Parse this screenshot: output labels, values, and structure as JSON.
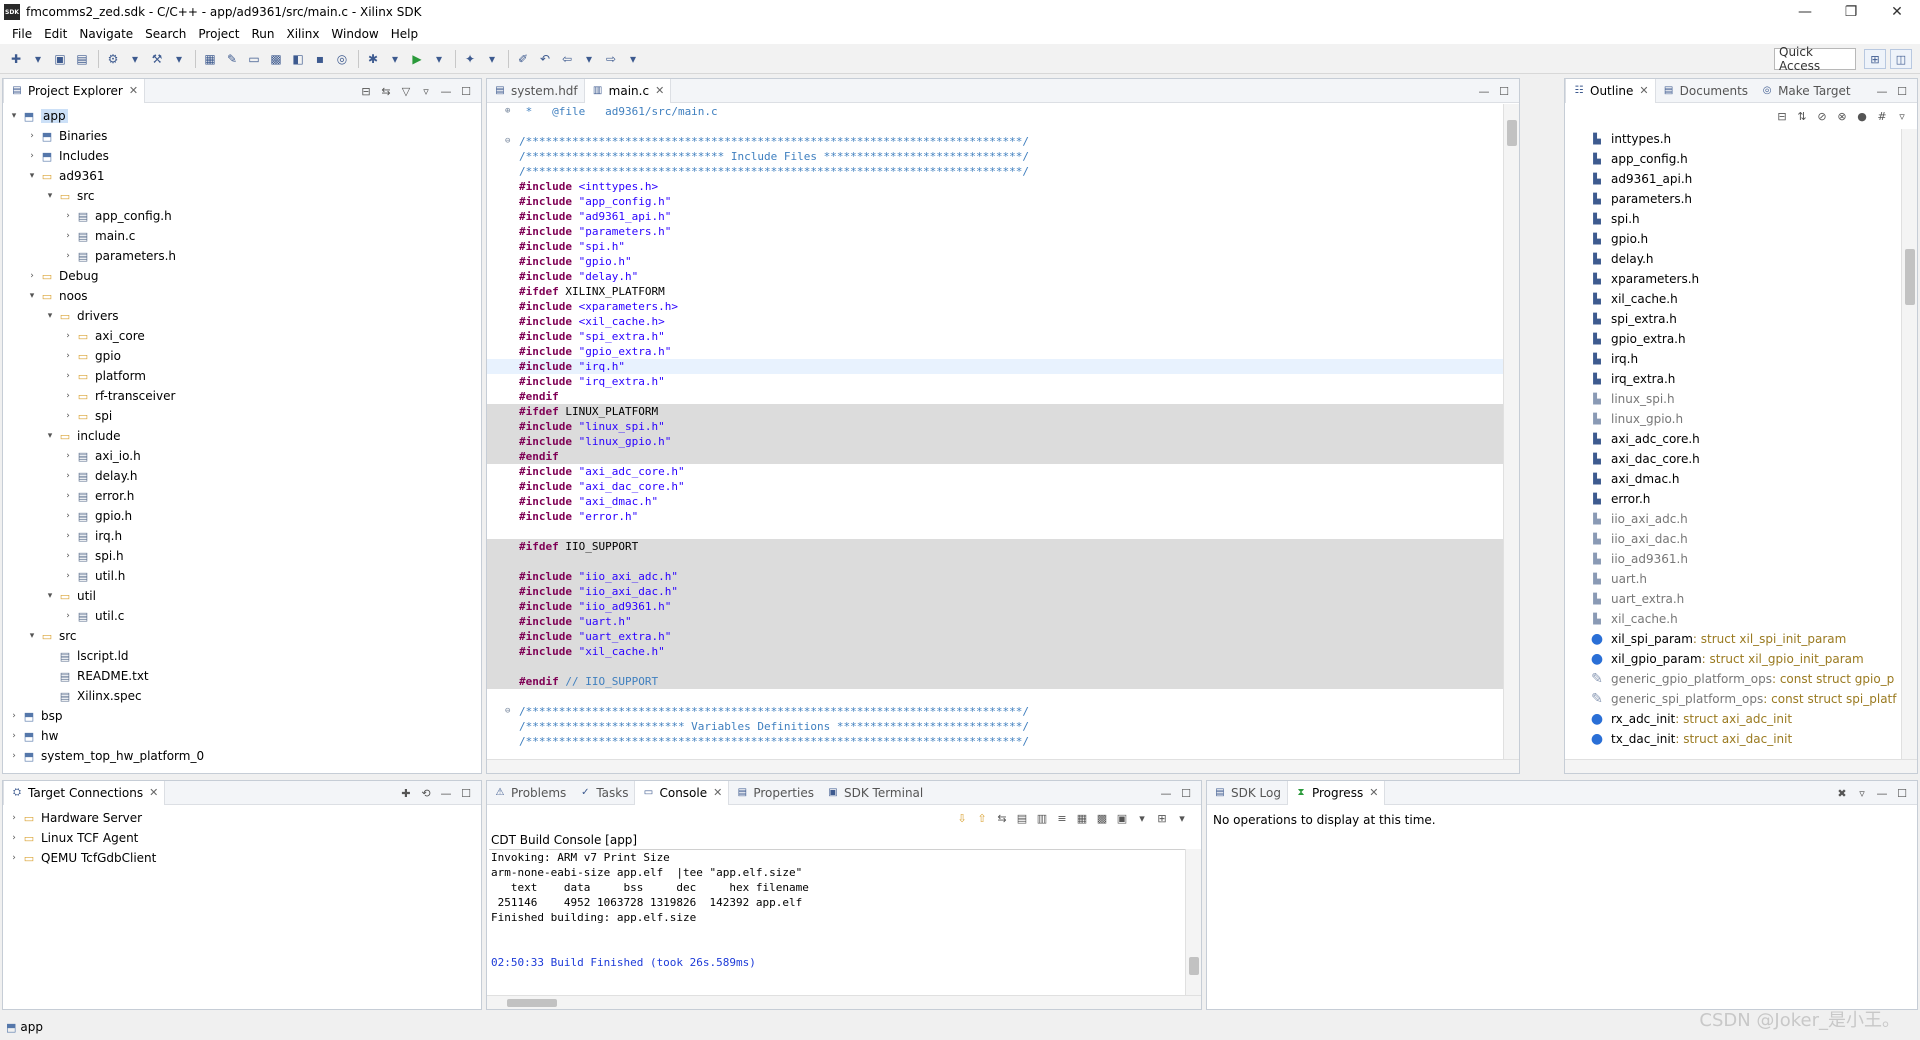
{
  "window": {
    "title": "fmcomms2_zed.sdk - C/C++ - app/ad9361/src/main.c - Xilinx SDK",
    "icon_text": "SDK",
    "controls": [
      "—",
      "❐",
      "✕"
    ]
  },
  "menu": [
    "File",
    "Edit",
    "Navigate",
    "Search",
    "Project",
    "Run",
    "Xilinx",
    "Window",
    "Help"
  ],
  "toolbar": {
    "quick_access": "Quick Access"
  },
  "project_explorer": {
    "title": "Project Explorer",
    "items": [
      {
        "label": "app",
        "depth": 0,
        "tw": "▾",
        "icon": "proj",
        "selected": true
      },
      {
        "label": "Binaries",
        "depth": 1,
        "tw": "›",
        "icon": "proj"
      },
      {
        "label": "Includes",
        "depth": 1,
        "tw": "›",
        "icon": "proj"
      },
      {
        "label": "ad9361",
        "depth": 1,
        "tw": "▾",
        "icon": "folder"
      },
      {
        "label": "src",
        "depth": 2,
        "tw": "▾",
        "icon": "folder"
      },
      {
        "label": "app_config.h",
        "depth": 3,
        "tw": "›",
        "icon": "file"
      },
      {
        "label": "main.c",
        "depth": 3,
        "tw": "›",
        "icon": "file"
      },
      {
        "label": "parameters.h",
        "depth": 3,
        "tw": "›",
        "icon": "file"
      },
      {
        "label": "Debug",
        "depth": 1,
        "tw": "›",
        "icon": "folder"
      },
      {
        "label": "noos",
        "depth": 1,
        "tw": "▾",
        "icon": "folder"
      },
      {
        "label": "drivers",
        "depth": 2,
        "tw": "▾",
        "icon": "folder"
      },
      {
        "label": "axi_core",
        "depth": 3,
        "tw": "›",
        "icon": "folder"
      },
      {
        "label": "gpio",
        "depth": 3,
        "tw": "›",
        "icon": "folder"
      },
      {
        "label": "platform",
        "depth": 3,
        "tw": "›",
        "icon": "folder"
      },
      {
        "label": "rf-transceiver",
        "depth": 3,
        "tw": "›",
        "icon": "folder"
      },
      {
        "label": "spi",
        "depth": 3,
        "tw": "›",
        "icon": "folder"
      },
      {
        "label": "include",
        "depth": 2,
        "tw": "▾",
        "icon": "folder"
      },
      {
        "label": "axi_io.h",
        "depth": 3,
        "tw": "›",
        "icon": "file"
      },
      {
        "label": "delay.h",
        "depth": 3,
        "tw": "›",
        "icon": "file"
      },
      {
        "label": "error.h",
        "depth": 3,
        "tw": "›",
        "icon": "file"
      },
      {
        "label": "gpio.h",
        "depth": 3,
        "tw": "›",
        "icon": "file"
      },
      {
        "label": "irq.h",
        "depth": 3,
        "tw": "›",
        "icon": "file"
      },
      {
        "label": "spi.h",
        "depth": 3,
        "tw": "›",
        "icon": "file"
      },
      {
        "label": "util.h",
        "depth": 3,
        "tw": "›",
        "icon": "file"
      },
      {
        "label": "util",
        "depth": 2,
        "tw": "▾",
        "icon": "folder"
      },
      {
        "label": "util.c",
        "depth": 3,
        "tw": "›",
        "icon": "file"
      },
      {
        "label": "src",
        "depth": 1,
        "tw": "▾",
        "icon": "folder"
      },
      {
        "label": "lscript.ld",
        "depth": 2,
        "tw": "",
        "icon": "file"
      },
      {
        "label": "README.txt",
        "depth": 2,
        "tw": "",
        "icon": "file"
      },
      {
        "label": "Xilinx.spec",
        "depth": 2,
        "tw": "",
        "icon": "file"
      },
      {
        "label": "bsp",
        "depth": 0,
        "tw": "›",
        "icon": "proj"
      },
      {
        "label": "hw",
        "depth": 0,
        "tw": "›",
        "icon": "proj"
      },
      {
        "label": "system_top_hw_platform_0",
        "depth": 0,
        "tw": "›",
        "icon": "proj"
      }
    ]
  },
  "target_connections": {
    "title": "Target Connections",
    "items": [
      "Hardware Server",
      "Linux TCF Agent",
      "QEMU TcfGdbClient"
    ]
  },
  "editor": {
    "tabs": [
      "system.hdf",
      "main.c"
    ],
    "lines": [
      {
        "fold": "⊕",
        "bg": "",
        "parts": [
          [
            "c-cmt",
            " *   @file   ad9361/src/main.c"
          ]
        ]
      },
      {
        "fold": "",
        "bg": "",
        "parts": [
          [
            "c-norm",
            ""
          ]
        ]
      },
      {
        "fold": "⊖",
        "bg": "",
        "parts": [
          [
            "c-cmt",
            "/***************************************************************************/"
          ]
        ]
      },
      {
        "fold": "",
        "bg": "",
        "parts": [
          [
            "c-cmt",
            "/****************************** Include Files ******************************/"
          ]
        ]
      },
      {
        "fold": "",
        "bg": "",
        "parts": [
          [
            "c-cmt",
            "/***************************************************************************/"
          ]
        ]
      },
      {
        "fold": "",
        "bg": "",
        "parts": [
          [
            "c-kw",
            "#include"
          ],
          [
            "c-str",
            " <inttypes.h>"
          ]
        ]
      },
      {
        "fold": "",
        "bg": "",
        "parts": [
          [
            "c-kw",
            "#include"
          ],
          [
            "c-str",
            " \"app_config.h\""
          ]
        ]
      },
      {
        "fold": "",
        "bg": "",
        "parts": [
          [
            "c-kw",
            "#include"
          ],
          [
            "c-str",
            " \"ad9361_api.h\""
          ]
        ]
      },
      {
        "fold": "",
        "bg": "",
        "parts": [
          [
            "c-kw",
            "#include"
          ],
          [
            "c-str",
            " \"parameters.h\""
          ]
        ]
      },
      {
        "fold": "",
        "bg": "",
        "parts": [
          [
            "c-kw",
            "#include"
          ],
          [
            "c-str",
            " \"spi.h\""
          ]
        ]
      },
      {
        "fold": "",
        "bg": "",
        "parts": [
          [
            "c-kw",
            "#include"
          ],
          [
            "c-str",
            " \"gpio.h\""
          ]
        ]
      },
      {
        "fold": "",
        "bg": "",
        "parts": [
          [
            "c-kw",
            "#include"
          ],
          [
            "c-str",
            " \"delay.h\""
          ]
        ]
      },
      {
        "fold": "",
        "bg": "",
        "parts": [
          [
            "c-kw",
            "#ifdef"
          ],
          [
            "c-norm",
            " XILINX_PLATFORM"
          ]
        ]
      },
      {
        "fold": "",
        "bg": "",
        "parts": [
          [
            "c-kw",
            "#include"
          ],
          [
            "c-str",
            " <xparameters.h>"
          ]
        ]
      },
      {
        "fold": "",
        "bg": "",
        "parts": [
          [
            "c-kw",
            "#include"
          ],
          [
            "c-str",
            " <xil_cache.h>"
          ]
        ]
      },
      {
        "fold": "",
        "bg": "",
        "parts": [
          [
            "c-kw",
            "#include"
          ],
          [
            "c-str",
            " \"spi_extra.h\""
          ]
        ]
      },
      {
        "fold": "",
        "bg": "",
        "parts": [
          [
            "c-kw",
            "#include"
          ],
          [
            "c-str",
            " \"gpio_extra.h\""
          ]
        ]
      },
      {
        "fold": "",
        "bg": "cur",
        "parts": [
          [
            "c-kw",
            "#include"
          ],
          [
            "c-str",
            " \"irq.h\""
          ]
        ]
      },
      {
        "fold": "",
        "bg": "",
        "parts": [
          [
            "c-kw",
            "#include"
          ],
          [
            "c-str",
            " \"irq_extra.h\""
          ]
        ]
      },
      {
        "fold": "",
        "bg": "",
        "parts": [
          [
            "c-kw",
            "#endif"
          ]
        ]
      },
      {
        "fold": "",
        "bg": "gray",
        "parts": [
          [
            "c-kw",
            "#ifdef"
          ],
          [
            "c-norm",
            " LINUX_PLATFORM"
          ]
        ]
      },
      {
        "fold": "",
        "bg": "gray",
        "parts": [
          [
            "c-kw",
            "#include"
          ],
          [
            "c-str",
            " \"linux_spi.h\""
          ]
        ]
      },
      {
        "fold": "",
        "bg": "gray",
        "parts": [
          [
            "c-kw",
            "#include"
          ],
          [
            "c-str",
            " \"linux_gpio.h\""
          ]
        ]
      },
      {
        "fold": "",
        "bg": "gray",
        "parts": [
          [
            "c-kw",
            "#endif"
          ]
        ]
      },
      {
        "fold": "",
        "bg": "",
        "parts": [
          [
            "c-kw",
            "#include"
          ],
          [
            "c-str",
            " \"axi_adc_core.h\""
          ]
        ]
      },
      {
        "fold": "",
        "bg": "",
        "parts": [
          [
            "c-kw",
            "#include"
          ],
          [
            "c-str",
            " \"axi_dac_core.h\""
          ]
        ]
      },
      {
        "fold": "",
        "bg": "",
        "parts": [
          [
            "c-kw",
            "#include"
          ],
          [
            "c-str",
            " \"axi_dmac.h\""
          ]
        ]
      },
      {
        "fold": "",
        "bg": "",
        "parts": [
          [
            "c-kw",
            "#include"
          ],
          [
            "c-str",
            " \"error.h\""
          ]
        ]
      },
      {
        "fold": "",
        "bg": "",
        "parts": [
          [
            "c-norm",
            ""
          ]
        ]
      },
      {
        "fold": "",
        "bg": "gray",
        "parts": [
          [
            "c-kw",
            "#ifdef"
          ],
          [
            "c-norm",
            " IIO_SUPPORT"
          ]
        ]
      },
      {
        "fold": "",
        "bg": "gray",
        "parts": [
          [
            "c-norm",
            ""
          ]
        ]
      },
      {
        "fold": "",
        "bg": "gray",
        "parts": [
          [
            "c-kw",
            "#include"
          ],
          [
            "c-str",
            " \"iio_axi_adc.h\""
          ]
        ]
      },
      {
        "fold": "",
        "bg": "gray",
        "parts": [
          [
            "c-kw",
            "#include"
          ],
          [
            "c-str",
            " \"iio_axi_dac.h\""
          ]
        ]
      },
      {
        "fold": "",
        "bg": "gray",
        "parts": [
          [
            "c-kw",
            "#include"
          ],
          [
            "c-str",
            " \"iio_ad9361.h\""
          ]
        ]
      },
      {
        "fold": "",
        "bg": "gray",
        "parts": [
          [
            "c-kw",
            "#include"
          ],
          [
            "c-str",
            " \"uart.h\""
          ]
        ]
      },
      {
        "fold": "",
        "bg": "gray",
        "parts": [
          [
            "c-kw",
            "#include"
          ],
          [
            "c-str",
            " \"uart_extra.h\""
          ]
        ]
      },
      {
        "fold": "",
        "bg": "gray",
        "parts": [
          [
            "c-kw",
            "#include"
          ],
          [
            "c-str",
            " \"xil_cache.h\""
          ]
        ]
      },
      {
        "fold": "",
        "bg": "gray",
        "parts": [
          [
            "c-norm",
            ""
          ]
        ]
      },
      {
        "fold": "",
        "bg": "gray",
        "parts": [
          [
            "c-kw",
            "#endif"
          ],
          [
            "c-cmt",
            " // IIO_SUPPORT"
          ]
        ]
      },
      {
        "fold": "",
        "bg": "",
        "parts": [
          [
            "c-norm",
            ""
          ]
        ]
      },
      {
        "fold": "⊖",
        "bg": "",
        "parts": [
          [
            "c-cmt",
            "/***************************************************************************/"
          ]
        ]
      },
      {
        "fold": "",
        "bg": "",
        "parts": [
          [
            "c-cmt",
            "/************************ Variables Definitions ****************************/"
          ]
        ]
      },
      {
        "fold": "",
        "bg": "",
        "parts": [
          [
            "c-cmt",
            "/***************************************************************************/"
          ]
        ]
      }
    ]
  },
  "outline": {
    "tabs": [
      "Outline",
      "Documents",
      "Make Target"
    ],
    "items": [
      {
        "name": "inttypes.h",
        "type": "",
        "kind": "inc"
      },
      {
        "name": "app_config.h",
        "type": "",
        "kind": "inc"
      },
      {
        "name": "ad9361_api.h",
        "type": "",
        "kind": "inc"
      },
      {
        "name": "parameters.h",
        "type": "",
        "kind": "inc"
      },
      {
        "name": "spi.h",
        "type": "",
        "kind": "inc"
      },
      {
        "name": "gpio.h",
        "type": "",
        "kind": "inc"
      },
      {
        "name": "delay.h",
        "type": "",
        "kind": "inc"
      },
      {
        "name": "xparameters.h",
        "type": "",
        "kind": "inc"
      },
      {
        "name": "xil_cache.h",
        "type": "",
        "kind": "inc"
      },
      {
        "name": "spi_extra.h",
        "type": "",
        "kind": "inc"
      },
      {
        "name": "gpio_extra.h",
        "type": "",
        "kind": "inc"
      },
      {
        "name": "irq.h",
        "type": "",
        "kind": "inc"
      },
      {
        "name": "irq_extra.h",
        "type": "",
        "kind": "inc"
      },
      {
        "name": "linux_spi.h",
        "type": "",
        "kind": "inc-dim"
      },
      {
        "name": "linux_gpio.h",
        "type": "",
        "kind": "inc-dim"
      },
      {
        "name": "axi_adc_core.h",
        "type": "",
        "kind": "inc"
      },
      {
        "name": "axi_dac_core.h",
        "type": "",
        "kind": "inc"
      },
      {
        "name": "axi_dmac.h",
        "type": "",
        "kind": "inc"
      },
      {
        "name": "error.h",
        "type": "",
        "kind": "inc"
      },
      {
        "name": "iio_axi_adc.h",
        "type": "",
        "kind": "inc-dim"
      },
      {
        "name": "iio_axi_dac.h",
        "type": "",
        "kind": "inc-dim"
      },
      {
        "name": "iio_ad9361.h",
        "type": "",
        "kind": "inc-dim"
      },
      {
        "name": "uart.h",
        "type": "",
        "kind": "inc-dim"
      },
      {
        "name": "uart_extra.h",
        "type": "",
        "kind": "inc-dim"
      },
      {
        "name": "xil_cache.h",
        "type": "",
        "kind": "inc-dim"
      },
      {
        "name": "xil_spi_param",
        "type": " : struct xil_spi_init_param",
        "kind": "var"
      },
      {
        "name": "xil_gpio_param",
        "type": " : struct xil_gpio_init_param",
        "kind": "var"
      },
      {
        "name": "generic_gpio_platform_ops",
        "type": " : const struct gpio_p",
        "kind": "var-dim"
      },
      {
        "name": "generic_spi_platform_ops",
        "type": " : const struct spi_platf",
        "kind": "var-dim"
      },
      {
        "name": "rx_adc_init",
        "type": " : struct axi_adc_init",
        "kind": "var"
      },
      {
        "name": "tx_dac_init",
        "type": " : struct axi_dac_init",
        "kind": "var"
      }
    ]
  },
  "console_panel": {
    "tabs": [
      "Problems",
      "Tasks",
      "Console",
      "Properties",
      "SDK Terminal"
    ],
    "title": "CDT Build Console [app]",
    "lines": [
      {
        "text": "Invoking: ARM v7 Print Size",
        "cls": ""
      },
      {
        "text": "arm-none-eabi-size app.elf  |tee \"app.elf.size\"",
        "cls": ""
      },
      {
        "text": "   text    data     bss     dec     hex filename",
        "cls": ""
      },
      {
        "text": " 251146    4952 1063728 1319826  142392 app.elf",
        "cls": ""
      },
      {
        "text": "Finished building: app.elf.size",
        "cls": ""
      },
      {
        "text": "",
        "cls": ""
      },
      {
        "text": "",
        "cls": ""
      },
      {
        "text": "02:50:33 Build Finished (took 26s.589ms)",
        "cls": "con-blue"
      }
    ]
  },
  "progress_panel": {
    "tabs": [
      "SDK Log",
      "Progress"
    ],
    "message": "No operations to display at this time."
  },
  "status": {
    "selected": "app",
    "watermark": "CSDN @Joker_是小王。"
  }
}
